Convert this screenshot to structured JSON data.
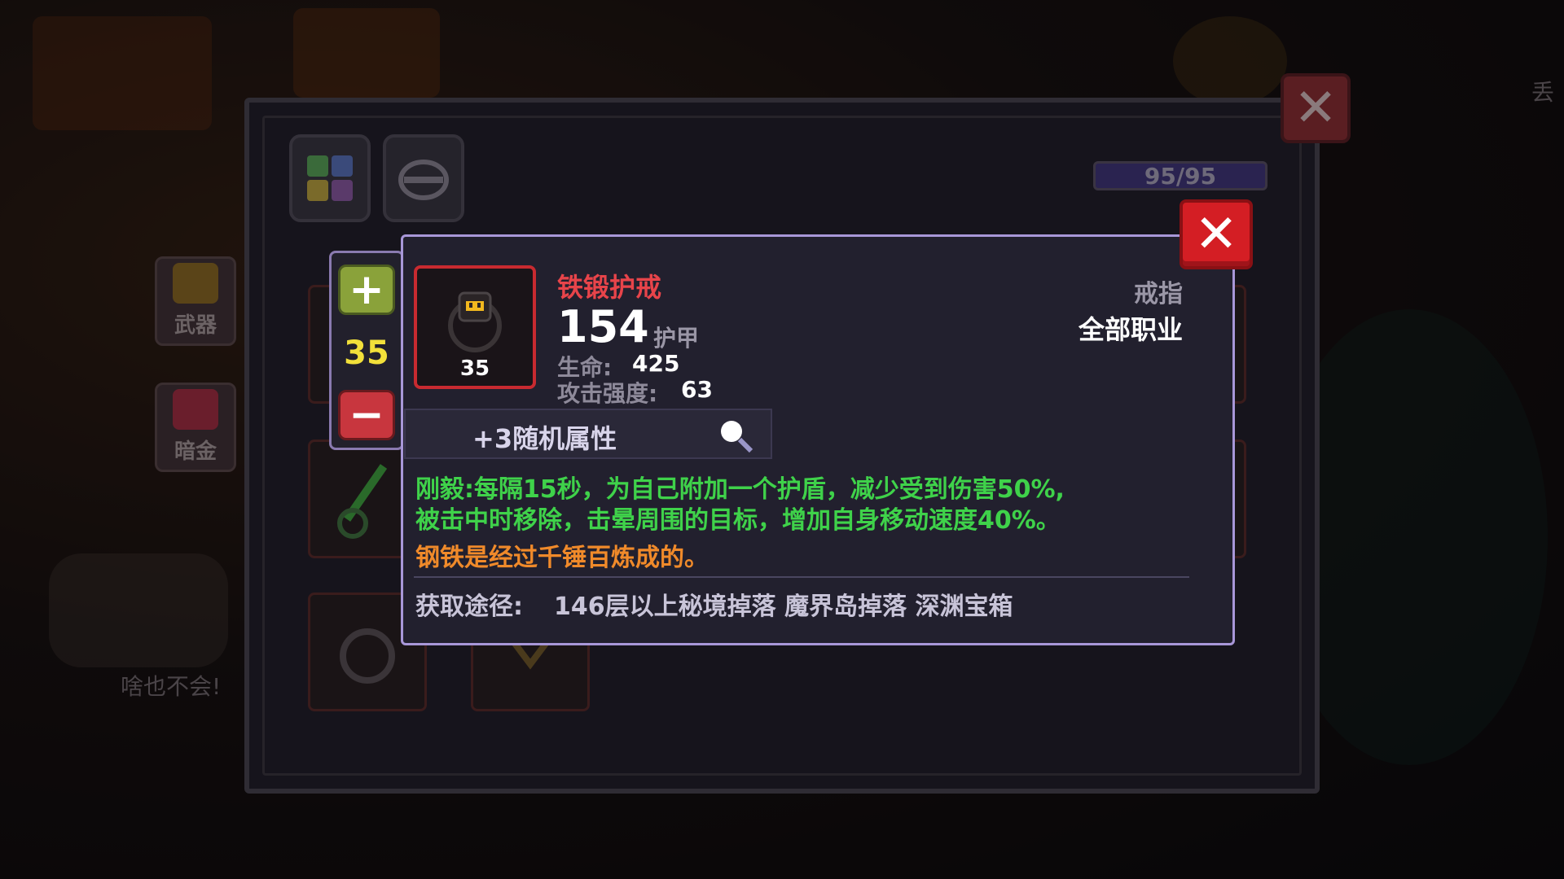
{
  "background": {
    "side_tabs": [
      {
        "label": "武器"
      },
      {
        "label": "暗金"
      }
    ],
    "npc_caption": "啥也不会!",
    "top_right_hint": "丢"
  },
  "inventory": {
    "capacity": "95/95",
    "category_icons": [
      "grid-icon",
      "helmet-icon"
    ],
    "close_icon": "close-icon"
  },
  "level_selector": {
    "value": "35",
    "plus_label": "+",
    "minus_label": "−"
  },
  "item": {
    "name": "铁锻护戒",
    "level": "35",
    "armor_value": "154",
    "armor_label": "护甲",
    "stats": [
      {
        "label": "生命:",
        "value": "425"
      },
      {
        "label": "攻击强度:",
        "value": "63"
      }
    ],
    "type": "戒指",
    "class_restriction": "全部职业",
    "random_attributes": "+3随机属性",
    "effect_line1": "刚毅:每隔15秒，为自己附加一个护盾，减少受到伤害50%,",
    "effect_line2": "被击中时移除，击晕周围的目标，增加自身移动速度40%。",
    "flavor": "钢铁是经过千锤百炼成的。",
    "source_label": "获取途径:",
    "sources": "146层以上秘境掉落 魔界岛掉落 深渊宝箱"
  },
  "colors": {
    "item_name": "#e8444a",
    "effect": "#3fd24a",
    "flavor": "#f08a2a",
    "tooltip_border": "#a897d8",
    "close_button": "#d41e24",
    "level_value": "#f2e03a"
  }
}
